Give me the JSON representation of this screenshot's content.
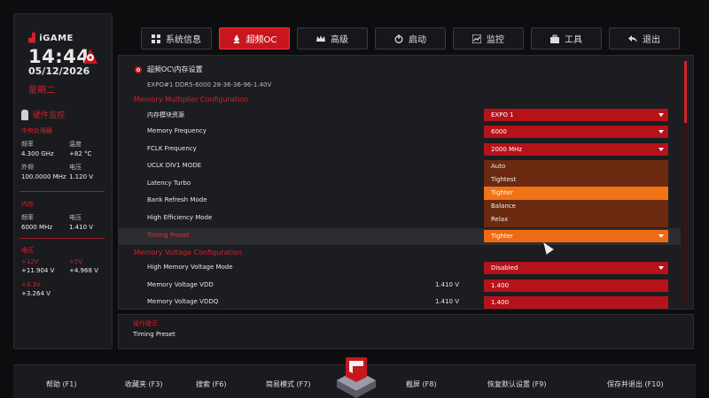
{
  "brand": {
    "logo_text": "iGAME"
  },
  "clock": {
    "time": "14:44",
    "date": "05/12/2026",
    "weekday": "星期二"
  },
  "hw_monitor": {
    "title": "硬件监控",
    "cpu": {
      "title": "中央处理器",
      "freq_label": "频率",
      "freq": "4.300 GHz",
      "temp_label": "温度",
      "temp": "+82 °C",
      "bclk_label": "外频",
      "bclk": "100.0000 MHz",
      "volt_label": "电压",
      "volt": "1.120 V"
    },
    "mem": {
      "title": "内存",
      "freq_label": "频率",
      "freq": "6000 MHz",
      "volt_label": "电压",
      "volt": "1.410 V"
    },
    "voltage": {
      "title": "电压",
      "v12_label": "+12V",
      "v12": "+11.904 V",
      "v5_label": "+5V",
      "v5": "+4.968 V",
      "v33_label": "+3.3V",
      "v33": "+3.264 V"
    }
  },
  "tabs": [
    {
      "label": "系统信息",
      "icon": "grid-icon"
    },
    {
      "label": "超频OC",
      "icon": "rocket-icon",
      "active": true
    },
    {
      "label": "高级",
      "icon": "crown-icon"
    },
    {
      "label": "启动",
      "icon": "power-icon"
    },
    {
      "label": "监控",
      "icon": "chart-icon"
    },
    {
      "label": "工具",
      "icon": "toolbox-icon"
    },
    {
      "label": "退出",
      "icon": "back-arrow-icon"
    }
  ],
  "main": {
    "breadcrumb": "超频OC\\内存设置",
    "profile": "EXPO#1 DDR5-6000 28-36-36-96-1.40V",
    "group1": "Memory Multiplier Configuration",
    "group2": "Memory Voltage Configuration",
    "rows": [
      {
        "label": "内存模块资源",
        "value": "EXPO 1"
      },
      {
        "label": "Memory Frequency",
        "value": "6000"
      },
      {
        "label": "FCLK Frequency",
        "value": "2000 MHz"
      },
      {
        "label": "UCLK DIV1 MODE",
        "value": ""
      },
      {
        "label": "Latency Turbo",
        "value": ""
      },
      {
        "label": "Bank Refresh Mode",
        "value": ""
      },
      {
        "label": "High Efficiency Mode",
        "value": ""
      },
      {
        "label": "Timing Preset",
        "value": "Tighter"
      }
    ],
    "volt_rows": [
      {
        "label": "High Memory Voltage Mode",
        "reading": "",
        "value": "Disabled"
      },
      {
        "label": "Memory Voltage VDD",
        "reading": "1.410 V",
        "value": "1.400"
      },
      {
        "label": "Memory Voltage VDDQ",
        "reading": "1.410 V",
        "value": "1.400"
      }
    ],
    "dropdown_options": [
      "Auto",
      "Tightest",
      "Tighter",
      "Balance",
      "Relax"
    ],
    "dropdown_highlighted": "Tighter"
  },
  "hint": {
    "title": "操作提示",
    "text": "Timing Preset"
  },
  "function_keys": [
    {
      "label": "帮助 (F1)"
    },
    {
      "label": "收藏夹 (F3)"
    },
    {
      "label": "搜索 (F6)"
    },
    {
      "label": "简易模式 (F7)"
    },
    {
      "label": "截屏 (F8)"
    },
    {
      "label": "恢复默认设置 (F9)"
    },
    {
      "label": "保存并退出 (F10)"
    }
  ],
  "colors": {
    "accent": "#c8161e",
    "highlight": "#f06a14",
    "background": "#0d0d0f"
  }
}
